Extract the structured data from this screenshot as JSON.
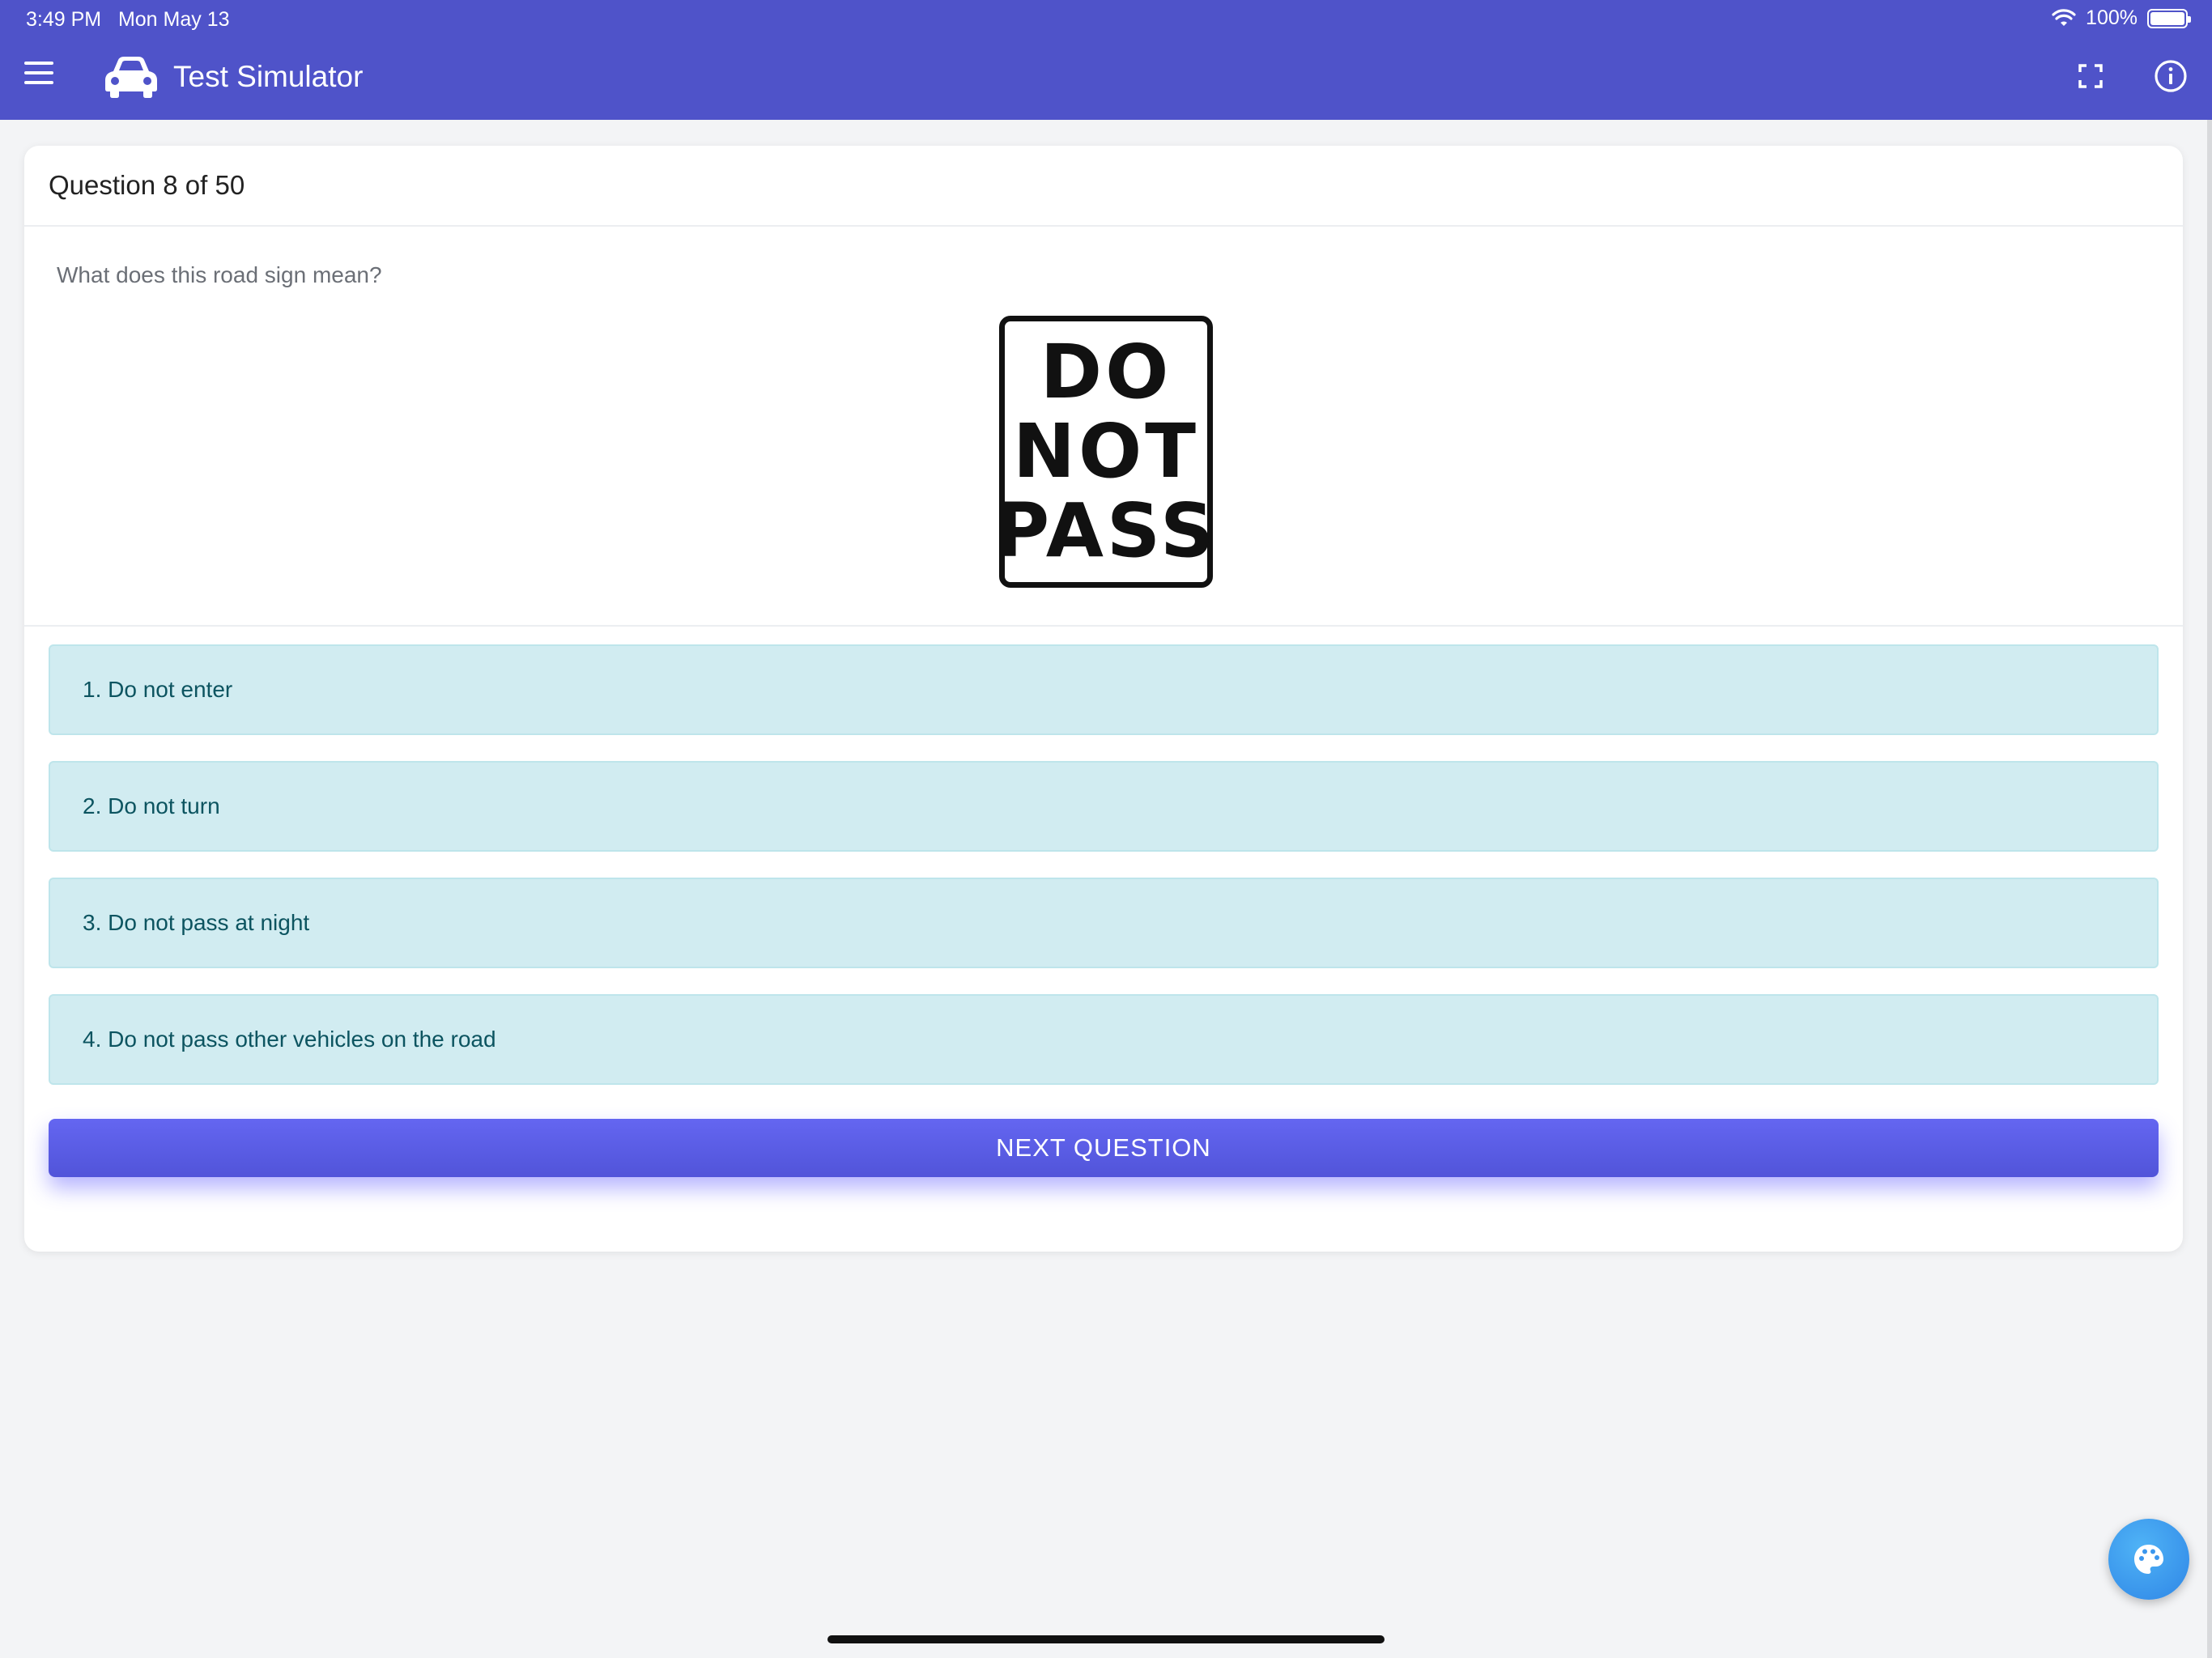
{
  "status_bar": {
    "time": "3:49 PM",
    "date": "Mon May 13",
    "battery": "100%"
  },
  "app_bar": {
    "title": "Test Simulator",
    "icons": [
      "menu-icon",
      "car-icon",
      "fullscreen-icon",
      "info-icon"
    ],
    "color": "#4f53c9"
  },
  "question": {
    "counter": "Question 8 of 50",
    "text": "What does this road sign mean?",
    "sign_lines": [
      "DO",
      "NOT",
      "PASS"
    ]
  },
  "options": [
    {
      "label": "1. Do not enter"
    },
    {
      "label": "2. Do not turn"
    },
    {
      "label": "3. Do not pass at night"
    },
    {
      "label": "4. Do not pass other vehicles on the road"
    }
  ],
  "next_button": {
    "label": "NEXT QUESTION",
    "color": "#5f61ec"
  },
  "fab": {
    "icon": "palette-icon",
    "color": "#3b97ee"
  },
  "colors": {
    "option_bg": "#d1ecf1",
    "option_text": "#0c5460",
    "page_bg": "#f3f4f6"
  }
}
